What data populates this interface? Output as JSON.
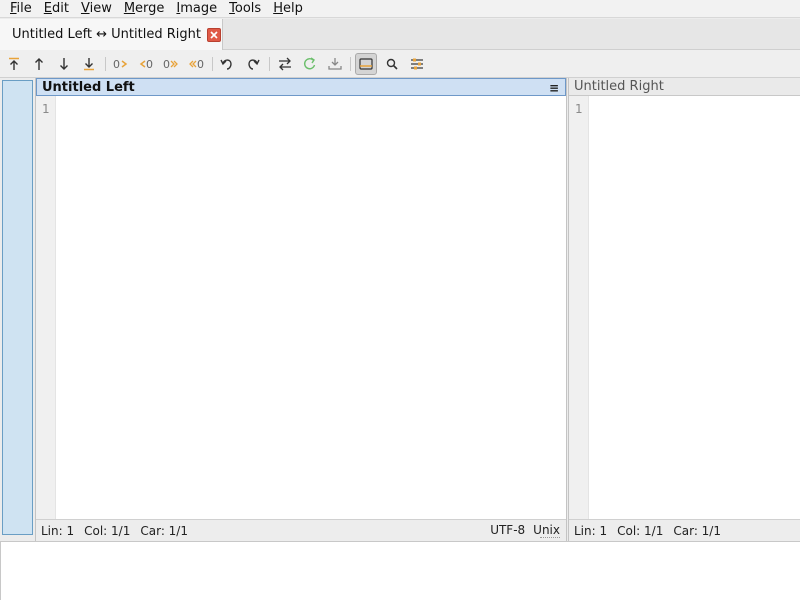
{
  "menubar": {
    "items": [
      {
        "pre": "",
        "u": "F",
        "post": "ile"
      },
      {
        "pre": "",
        "u": "E",
        "post": "dit"
      },
      {
        "pre": "",
        "u": "V",
        "post": "iew"
      },
      {
        "pre": "",
        "u": "M",
        "post": "erge"
      },
      {
        "pre": "",
        "u": "I",
        "post": "mage"
      },
      {
        "pre": "",
        "u": "T",
        "post": "ools"
      },
      {
        "pre": "",
        "u": "H",
        "post": "elp"
      }
    ]
  },
  "tab": {
    "label": "Untitled Left ↔ Untitled Right"
  },
  "toolbar": {
    "icons": [
      "first-diff-icon",
      "prev-diff-icon",
      "next-diff-icon",
      "last-diff-icon",
      "copy-left-to-right-icon",
      "copy-right-to-left-icon",
      "copy-all-left-to-right-icon",
      "copy-all-right-to-left-icon",
      "undo-icon",
      "redo-icon",
      "swap-icon",
      "refresh-icon",
      "save-icon",
      "location-pane-icon",
      "search-icon",
      "options-icon"
    ],
    "accent": "#e8a33a"
  },
  "left_pane": {
    "title": "Untitled Left",
    "line_number": "1",
    "status": {
      "line": "Lin: 1",
      "col": "Col: 1/1",
      "car": "Car: 1/1",
      "encoding": "UTF-8",
      "eol": "Unix"
    }
  },
  "right_pane": {
    "title": "Untitled Right",
    "line_number": "1",
    "status": {
      "line": "Lin: 1",
      "col": "Col: 1/1",
      "car": "Car: 1/1"
    }
  }
}
